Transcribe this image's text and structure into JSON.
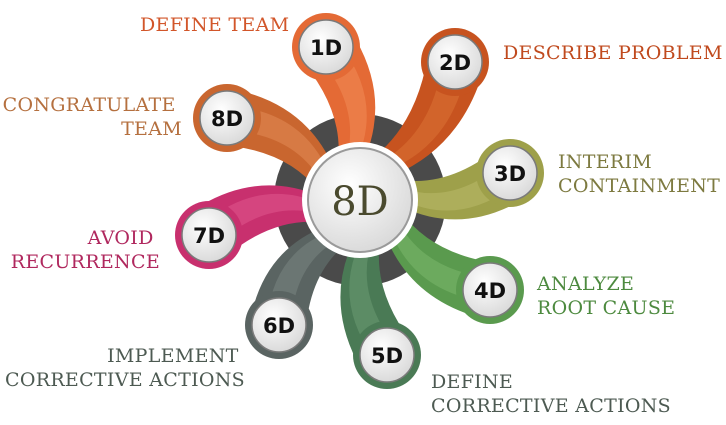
{
  "center": {
    "label": "8D"
  },
  "steps": [
    {
      "id": "step-1",
      "code": "1D",
      "lines": [
        "DEFINE TEAM"
      ],
      "color": "#e46a35",
      "light": "#f08a55"
    },
    {
      "id": "step-2",
      "code": "2D",
      "lines": [
        "DESCRIBE PROBLEM"
      ],
      "color": "#c7531f",
      "light": "#db7235"
    },
    {
      "id": "step-3",
      "code": "3D",
      "lines": [
        "INTERIM",
        "CONTAINMENT"
      ],
      "color": "#9ea04a",
      "light": "#b9ba6a"
    },
    {
      "id": "step-4",
      "code": "4D",
      "lines": [
        "ANALYZE",
        "ROOT CAUSE"
      ],
      "color": "#5a9a4e",
      "light": "#7bb86c"
    },
    {
      "id": "step-5",
      "code": "5D",
      "lines": [
        "DEFINE",
        "CORRECTIVE ACTIONS"
      ],
      "color": "#4a7a55",
      "light": "#6b9a72"
    },
    {
      "id": "step-6",
      "code": "6D",
      "lines": [
        "IMPLEMENT",
        "CORRECTIVE ACTIONS"
      ],
      "color": "#5a6462",
      "light": "#7a8582"
    },
    {
      "id": "step-7",
      "code": "7D",
      "lines": [
        "AVOID",
        "RECURRENCE"
      ],
      "color": "#c8306e",
      "light": "#e0578e"
    },
    {
      "id": "step-8",
      "code": "8D",
      "lines": [
        "CONGRATULATE",
        "TEAM"
      ],
      "color": "#c9662f",
      "light": "#e18a55"
    }
  ],
  "colors": {
    "disc_fill": "#e6e6e6",
    "ring": "#4a4a4a",
    "label_1": "#d2562a",
    "label_2": "#c04a1e",
    "label_3": "#7d7a40",
    "label_4": "#4d8a3f",
    "label_5": "#4d5a52",
    "label_6": "#4d5a52",
    "label_7": "#b0285e",
    "label_8": "#b5703f"
  }
}
